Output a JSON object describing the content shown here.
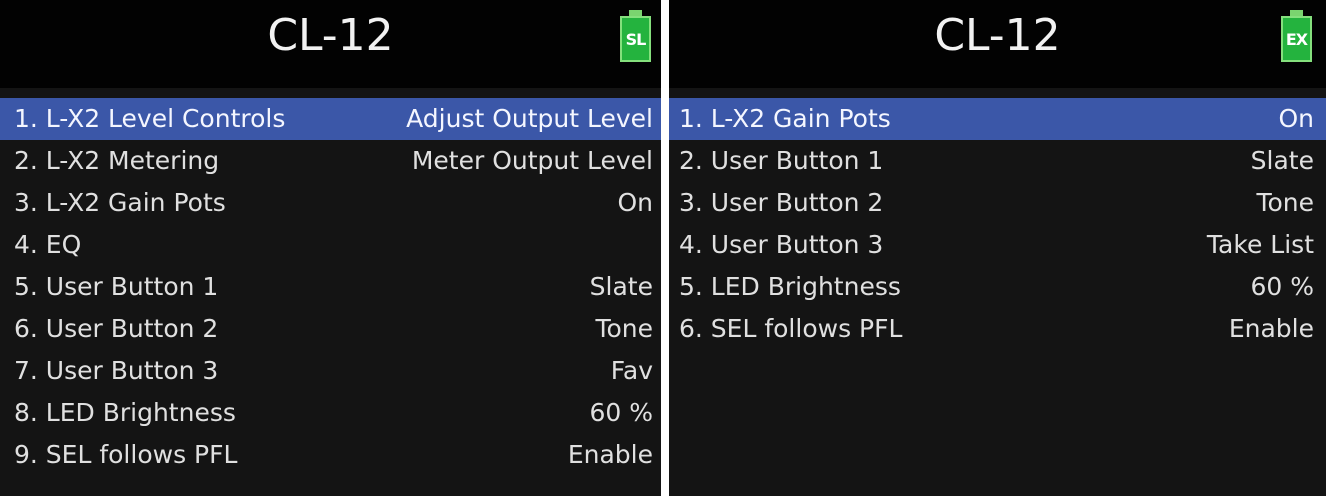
{
  "colors": {
    "screen_background": "#141414",
    "title_bar_background": "#020202",
    "selection_highlight": "#3b57a8",
    "battery_green": "#24b33e",
    "text": "#e0e0e0"
  },
  "screens": [
    {
      "title": "CL-12",
      "battery": {
        "icon": "battery-icon",
        "label": "SL"
      },
      "items": [
        {
          "label": "1. L-X2 Level Controls",
          "value": "Adjust Output Level",
          "selected": true
        },
        {
          "label": "2. L-X2 Metering",
          "value": "Meter Output Level"
        },
        {
          "label": "3. L-X2 Gain Pots",
          "value": "On"
        },
        {
          "label": "4. EQ",
          "value": ""
        },
        {
          "label": "5. User Button 1",
          "value": "Slate"
        },
        {
          "label": "6. User Button 2",
          "value": "Tone"
        },
        {
          "label": "7. User Button 3",
          "value": "Fav"
        },
        {
          "label": "8. LED Brightness",
          "value": "60 %"
        },
        {
          "label": "9. SEL follows PFL",
          "value": "Enable"
        }
      ]
    },
    {
      "title": "CL-12",
      "battery": {
        "icon": "battery-icon",
        "label": "EX"
      },
      "items": [
        {
          "label": "1. L-X2 Gain Pots",
          "value": "On",
          "selected": true
        },
        {
          "label": "2. User Button 1",
          "value": "Slate"
        },
        {
          "label": "3. User Button 2",
          "value": "Tone"
        },
        {
          "label": "4. User Button 3",
          "value": "Take List"
        },
        {
          "label": "5. LED Brightness",
          "value": "60 %"
        },
        {
          "label": "6. SEL follows PFL",
          "value": "Enable"
        }
      ]
    }
  ]
}
